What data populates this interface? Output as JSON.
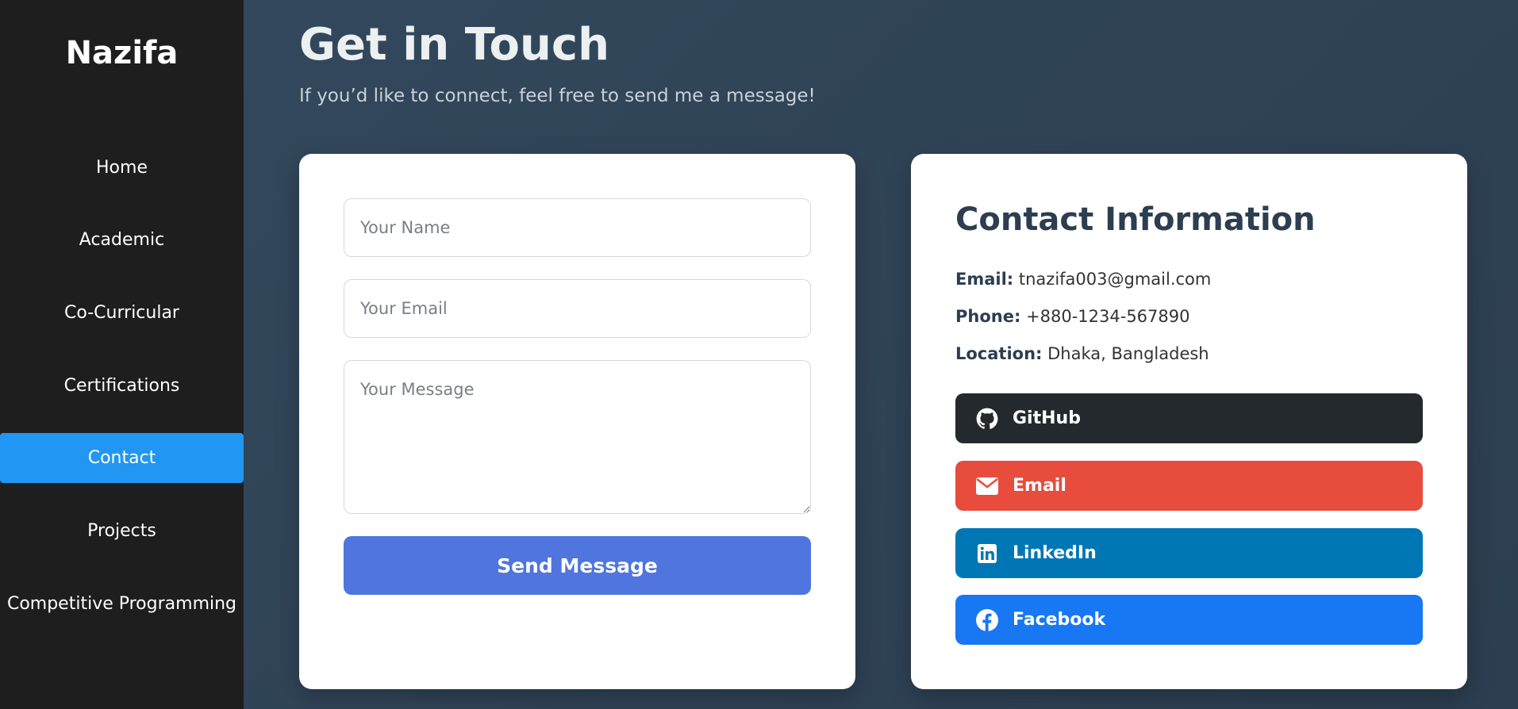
{
  "sidebar": {
    "brand": "Nazifa",
    "items": [
      {
        "label": "Home"
      },
      {
        "label": "Academic"
      },
      {
        "label": "Co-Curricular"
      },
      {
        "label": "Certifications"
      },
      {
        "label": "Contact",
        "active": true
      },
      {
        "label": "Projects"
      },
      {
        "label": "Competitive Programming"
      }
    ],
    "active_color": "#2196f3"
  },
  "header": {
    "title": "Get in Touch",
    "subtitle": "If you’d like to connect, feel free to send me a message!"
  },
  "form": {
    "name_placeholder": "Your Name",
    "email_placeholder": "Your Email",
    "message_placeholder": "Your Message",
    "submit_label": "Send Message",
    "submit_color": "#5075de"
  },
  "contact": {
    "title": "Contact Information",
    "email_label": "Email:",
    "email_value": "tnazifa003@gmail.com",
    "phone_label": "Phone:",
    "phone_value": "+880-1234-567890",
    "location_label": "Location:",
    "location_value": "Dhaka, Bangladesh",
    "links": [
      {
        "label": "GitHub",
        "icon": "github-icon",
        "color": "#24292e"
      },
      {
        "label": "Email",
        "icon": "envelope-icon",
        "color": "#e74c3c"
      },
      {
        "label": "LinkedIn",
        "icon": "linkedin-icon",
        "color": "#0077b5"
      },
      {
        "label": "Facebook",
        "icon": "facebook-icon",
        "color": "#1877f2"
      }
    ]
  }
}
